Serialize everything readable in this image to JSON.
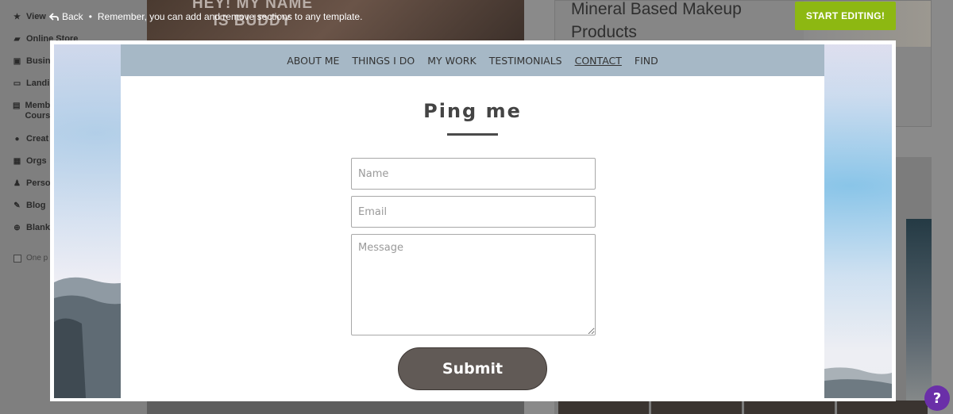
{
  "topbar": {
    "back_label": "Back",
    "separator": "•",
    "notice": "Remember, you can add and remove sections to any template."
  },
  "start_editing_label": "START EDITING!",
  "background": {
    "sidebar_items": [
      {
        "label": "View",
        "icon": "star-icon"
      },
      {
        "label": "Online Store",
        "icon": "cart-icon"
      },
      {
        "label": "Busin",
        "icon": "briefcase-icon"
      },
      {
        "label": "Landi",
        "icon": "window-icon"
      },
      {
        "label": "Memb Cours",
        "icon": "members-icon"
      },
      {
        "label": "Creat",
        "icon": "palette-icon"
      },
      {
        "label": "Orgs",
        "icon": "org-icon"
      },
      {
        "label": "Perso",
        "icon": "person-icon"
      },
      {
        "label": "Blog",
        "icon": "pen-icon"
      },
      {
        "label": "Blank",
        "icon": "plus-circle-icon"
      }
    ],
    "checkbox_label": "One p",
    "card1_text": "HEY! MY NAME IS BUDDY",
    "card2_title": "Mineral Based Makeup Products"
  },
  "preview": {
    "nav": [
      {
        "label": "ABOUT ME",
        "active": false
      },
      {
        "label": "THINGS I DO",
        "active": false
      },
      {
        "label": "MY WORK",
        "active": false
      },
      {
        "label": "TESTIMONIALS",
        "active": false
      },
      {
        "label": "CONTACT",
        "active": true
      },
      {
        "label": "FIND",
        "active": false
      }
    ],
    "title": "Ping me",
    "form": {
      "name_placeholder": "Name",
      "email_placeholder": "Email",
      "message_placeholder": "Message",
      "submit_label": "Submit"
    }
  },
  "help_label": "?",
  "colors": {
    "accent_green": "#8db812",
    "nav_bg": "#a6b8c6",
    "submit_bg": "#615a56",
    "help_purple": "#6a2fa8"
  }
}
